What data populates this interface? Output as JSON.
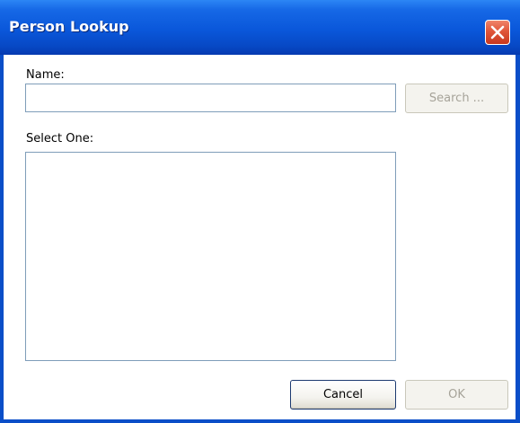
{
  "window": {
    "title": "Person Lookup",
    "close_icon": "close-icon"
  },
  "form": {
    "name_label": "Name:",
    "name_value": "",
    "select_label": "Select One:",
    "results": []
  },
  "buttons": {
    "search_label": "Search ...",
    "cancel_label": "Cancel",
    "ok_label": "OK"
  },
  "colors": {
    "titlebar": "#0a57da",
    "close_button": "#e0563a",
    "border_accent": "#7f9db9"
  }
}
